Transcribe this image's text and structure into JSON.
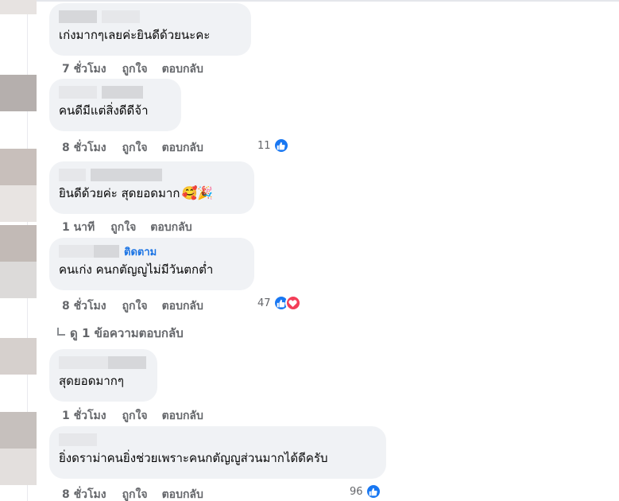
{
  "comments": [
    {
      "text": "เก่งมากๆเลยค่ะยินดีด้วยนะคะ",
      "time": "7 ชั่วโมง",
      "like": "ถูกใจ",
      "reply": "ตอบกลับ",
      "reactions": ""
    },
    {
      "text": "คนดีมีแต่สิ่งดีดีจ้า",
      "time": "8 ชั่วโมง",
      "like": "ถูกใจ",
      "reply": "ตอบกลับ",
      "reactions": "11"
    },
    {
      "text": "ยินดีด้วยค่ะ สุดยอดมาก",
      "emoji": "🥰🎉",
      "time": "1 นาที",
      "like": "ถูกใจ",
      "reply": "ตอบกลับ",
      "reactions": ""
    },
    {
      "follow": "ติดตาม",
      "text": "คนเก่ง คนกตัญญูไม่มีวันตกต่ำ",
      "time": "8 ชั่วโมง",
      "like": "ถูกใจ",
      "reply": "ตอบกลับ",
      "reactions": "47"
    },
    {
      "text": "สุดยอดมากๆ",
      "time": "1 ชั่วโมง",
      "like": "ถูกใจ",
      "reply": "ตอบกลับ",
      "reactions": ""
    },
    {
      "text": "ยิ่งดราม่าคนยิ่งช่วยเพราะคนกตัญญูส่วนมากได้ดีครับ",
      "time": "8 ชั่วโมง",
      "like": "ถูกใจ",
      "reply": "ตอบกลับ",
      "reactions": "96"
    }
  ],
  "view_replies": "ดู 1 ข้อความตอบกลับ",
  "icons": {
    "like": "thumbs-up-icon",
    "love": "heart-icon",
    "reply_arrow": "reply-arrow-icon"
  },
  "colors": {
    "bubble": "#f0f2f5",
    "meta": "#65676b",
    "link": "#1b74e4",
    "like": "#1877f2",
    "love": "#f33e58"
  }
}
